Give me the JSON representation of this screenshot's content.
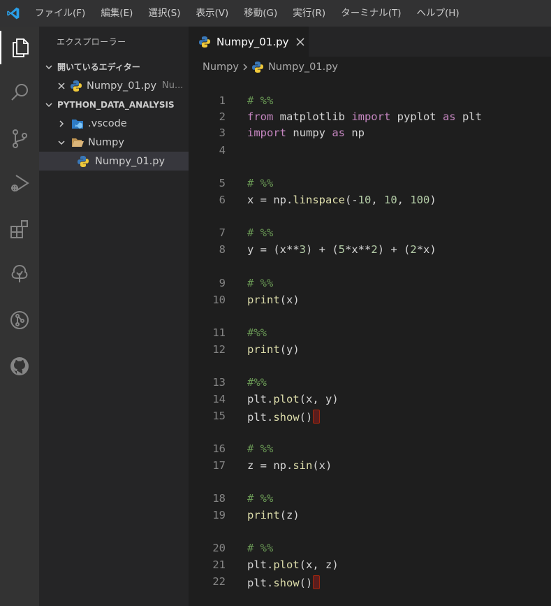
{
  "menu": [
    "ファイル(F)",
    "編集(E)",
    "選択(S)",
    "表示(V)",
    "移動(G)",
    "実行(R)",
    "ターミナル(T)",
    "ヘルプ(H)"
  ],
  "sidebar": {
    "title": "エクスプローラー",
    "open_editors": {
      "header": "開いているエディター",
      "file": "Numpy_01.py",
      "folder_hint": "Nu..."
    },
    "workspace": {
      "header": "PYTHON_DATA_ANALYSIS",
      "items": [
        ".vscode",
        "Numpy",
        "Numpy_01.py"
      ]
    }
  },
  "tab": {
    "label": "Numpy_01.py"
  },
  "breadcrumb": {
    "folder": "Numpy",
    "file": "Numpy_01.py"
  },
  "colors": {
    "accent": "#007acc",
    "comment": "#6a9955",
    "keyword": "#c586c0",
    "number": "#b5cea8",
    "function": "#dcdcaa"
  },
  "code_lines": [
    {
      "n": "1",
      "parts": [
        [
          "c",
          "# %%"
        ]
      ]
    },
    {
      "n": "2",
      "parts": [
        [
          "k",
          "from"
        ],
        [
          "v",
          " matplotlib "
        ],
        [
          "k",
          "import"
        ],
        [
          "v",
          " pyplot "
        ],
        [
          "k",
          "as"
        ],
        [
          "v",
          " plt"
        ]
      ]
    },
    {
      "n": "3",
      "parts": [
        [
          "k",
          "import"
        ],
        [
          "v",
          " numpy "
        ],
        [
          "k",
          "as"
        ],
        [
          "v",
          " np"
        ]
      ]
    },
    {
      "n": "4",
      "parts": []
    },
    {
      "n": "5",
      "parts": [
        [
          "c",
          "# %%"
        ]
      ]
    },
    {
      "n": "6",
      "parts": [
        [
          "v",
          "x = np."
        ],
        [
          "f",
          "linspace"
        ],
        [
          "v",
          "(-"
        ],
        [
          "n",
          "10"
        ],
        [
          "v",
          ", "
        ],
        [
          "n",
          "10"
        ],
        [
          "v",
          ", "
        ],
        [
          "n",
          "100"
        ],
        [
          "v",
          ")"
        ]
      ]
    },
    {
      "n": "7",
      "parts": [
        [
          "c",
          "# %%"
        ]
      ]
    },
    {
      "n": "8",
      "parts": [
        [
          "v",
          "y = (x**"
        ],
        [
          "n",
          "3"
        ],
        [
          "v",
          ") + ("
        ],
        [
          "n",
          "5"
        ],
        [
          "v",
          "*x**"
        ],
        [
          "n",
          "2"
        ],
        [
          "v",
          ") + ("
        ],
        [
          "n",
          "2"
        ],
        [
          "v",
          "*x)"
        ]
      ]
    },
    {
      "n": "9",
      "parts": [
        [
          "c",
          "# %%"
        ]
      ]
    },
    {
      "n": "10",
      "parts": [
        [
          "f",
          "print"
        ],
        [
          "v",
          "(x)"
        ]
      ]
    },
    {
      "n": "11",
      "parts": [
        [
          "c",
          "#%%"
        ]
      ]
    },
    {
      "n": "12",
      "parts": [
        [
          "f",
          "print"
        ],
        [
          "v",
          "(y)"
        ]
      ]
    },
    {
      "n": "13",
      "parts": [
        [
          "c",
          "#%%"
        ]
      ]
    },
    {
      "n": "14",
      "parts": [
        [
          "v",
          "plt."
        ],
        [
          "f",
          "plot"
        ],
        [
          "v",
          "(x, y)"
        ]
      ]
    },
    {
      "n": "15",
      "parts": [
        [
          "v",
          "plt."
        ],
        [
          "f",
          "show"
        ],
        [
          "v",
          "()"
        ]
      ],
      "marker": true
    },
    {
      "n": "16",
      "parts": [
        [
          "c",
          "# %%"
        ]
      ]
    },
    {
      "n": "17",
      "parts": [
        [
          "v",
          "z = np."
        ],
        [
          "f",
          "sin"
        ],
        [
          "v",
          "(x)"
        ]
      ]
    },
    {
      "n": "18",
      "parts": [
        [
          "c",
          "# %%"
        ]
      ]
    },
    {
      "n": "19",
      "parts": [
        [
          "f",
          "print"
        ],
        [
          "v",
          "(z)"
        ]
      ]
    },
    {
      "n": "20",
      "parts": [
        [
          "c",
          "# %%"
        ]
      ]
    },
    {
      "n": "21",
      "parts": [
        [
          "v",
          "plt."
        ],
        [
          "f",
          "plot"
        ],
        [
          "v",
          "(x, z)"
        ]
      ]
    },
    {
      "n": "22",
      "parts": [
        [
          "v",
          "plt."
        ],
        [
          "f",
          "show"
        ],
        [
          "v",
          "()"
        ]
      ],
      "marker": true
    }
  ]
}
